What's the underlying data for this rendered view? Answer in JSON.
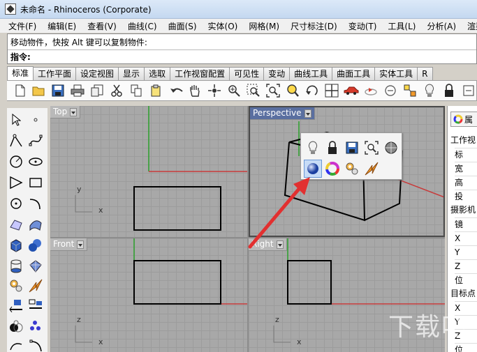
{
  "window": {
    "title": "未命名 - Rhinoceros (Corporate)"
  },
  "menu": [
    "文件(F)",
    "编辑(E)",
    "查看(V)",
    "曲线(C)",
    "曲面(S)",
    "实体(O)",
    "网格(M)",
    "尺寸标注(D)",
    "变动(T)",
    "工具(L)",
    "分析(A)",
    "渲染(R)"
  ],
  "command": {
    "history": "移动物件，快按 Alt 键可以复制物件:",
    "prompt": "指令:"
  },
  "tabs": [
    "标准",
    "工作平面",
    "设定视图",
    "显示",
    "选取",
    "工作视窗配置",
    "可见性",
    "变动",
    "曲线工具",
    "曲面工具",
    "实体工具",
    "R"
  ],
  "toolbar_icons": [
    "new-file-icon",
    "open-folder-icon",
    "save-icon",
    "print-icon",
    "import-icon",
    "cut-icon",
    "copy-icon",
    "paste-icon",
    "undo-icon",
    "pan-hand-icon",
    "rotate-view-icon",
    "zoom-icon",
    "zoom-window-icon",
    "zoom-extents-icon",
    "zoom-selected-icon",
    "rotate-camera-icon",
    "four-viewports-icon",
    "car-icon",
    "render-icon",
    "cplane-icon",
    "snap-icon",
    "light-bulb-icon",
    "lock-icon"
  ],
  "viewports": {
    "top": "Top",
    "perspective": "Perspective",
    "front": "Front",
    "right": "Right"
  },
  "axes": {
    "x": "x",
    "y": "y",
    "z": "z"
  },
  "popup_icons": [
    "light-bulb-icon",
    "lock-icon",
    "save-icon",
    "zoom-extents-icon",
    "sphere-icon",
    "render-sphere-icon",
    "color-wheel-icon",
    "gear-icon",
    "flash-icon"
  ],
  "properties": {
    "tab": "属",
    "rows": [
      {
        "text": "工作视",
        "type": "sec"
      },
      {
        "text": "标",
        "type": "sub"
      },
      {
        "text": "宽",
        "type": "sub"
      },
      {
        "text": "高",
        "type": "sub"
      },
      {
        "text": "投",
        "type": "sub"
      },
      {
        "text": "摄影机",
        "type": "sec"
      },
      {
        "text": "镜",
        "type": "sub"
      },
      {
        "text": "X",
        "type": "sub"
      },
      {
        "text": "Y",
        "type": "sub"
      },
      {
        "text": "Z",
        "type": "sub"
      },
      {
        "text": "位",
        "type": "sub"
      },
      {
        "text": "目标点",
        "type": "sec"
      },
      {
        "text": "X",
        "type": "sub"
      },
      {
        "text": "Y",
        "type": "sub"
      },
      {
        "text": "Z",
        "type": "sub"
      },
      {
        "text": "位",
        "type": "sub"
      }
    ]
  },
  "watermark": "下载吧"
}
